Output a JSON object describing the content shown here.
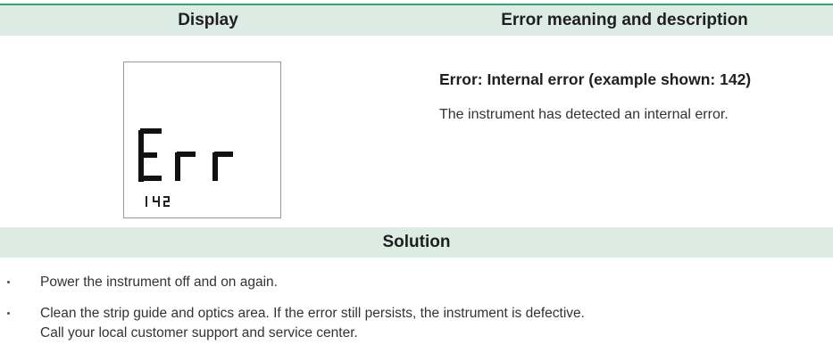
{
  "table": {
    "col_display_header": "Display",
    "col_error_header": "Error meaning and description",
    "lcd": {
      "main_text": "Err",
      "code_text": "142"
    },
    "error_title": "Error:  Internal error (example shown: 142)",
    "error_description": "The instrument has detected an internal error.",
    "solution_header": "Solution",
    "solutions": [
      "Power the instrument off and on again.",
      "Clean the strip guide and optics area. If the error still persists, the instrument is defective.",
      "Call your local customer support and service center."
    ]
  }
}
